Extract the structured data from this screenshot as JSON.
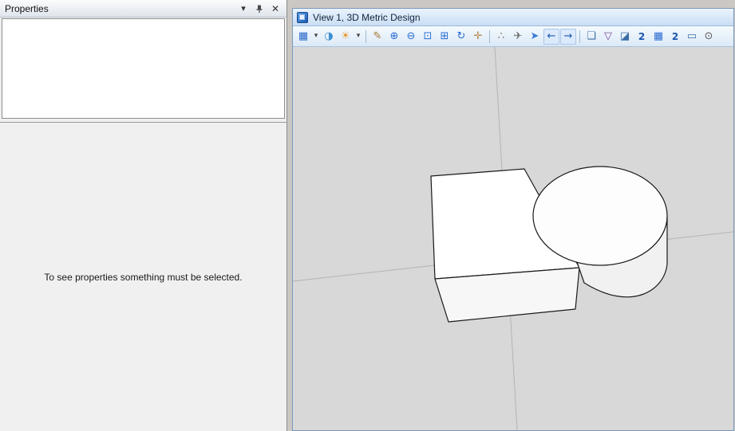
{
  "properties_panel": {
    "title": "Properties",
    "empty_message": "To see properties something must be selected.",
    "menu_caret_glyph": "▾",
    "close_glyph": "✕"
  },
  "view_window": {
    "title": "View 1, 3D Metric Design",
    "toolbar": {
      "items": [
        {
          "name": "view-attributes",
          "glyph": "▦",
          "color": "#2a66c8"
        },
        {
          "name": "view-attributes-caret",
          "glyph": "▾",
          "color": "#444",
          "narrow": true
        },
        {
          "name": "display-style",
          "glyph": "◑",
          "color": "#3a8fd0"
        },
        {
          "name": "adjust-view-brightness",
          "glyph": "☀",
          "color": "#e8982a"
        },
        {
          "name": "brightness-caret",
          "glyph": "▾",
          "color": "#444",
          "narrow": true
        },
        {
          "type": "separator"
        },
        {
          "name": "update-view",
          "glyph": "✎",
          "color": "#a9742f"
        },
        {
          "name": "zoom-in",
          "glyph": "⊕",
          "color": "#2b6cd4"
        },
        {
          "name": "zoom-out",
          "glyph": "⊖",
          "color": "#2b6cd4"
        },
        {
          "name": "window-area",
          "glyph": "⊡",
          "color": "#2b6cd4"
        },
        {
          "name": "fit-view",
          "glyph": "⊞",
          "color": "#2b6cd4"
        },
        {
          "name": "rotate-view",
          "glyph": "↻",
          "color": "#2b6cd4"
        },
        {
          "name": "pan-view",
          "glyph": "✛",
          "color": "#b8874f"
        },
        {
          "type": "separator"
        },
        {
          "name": "walk",
          "glyph": "∴",
          "color": "#7a6a5a"
        },
        {
          "name": "fly",
          "glyph": "✈",
          "color": "#6a6a6a"
        },
        {
          "name": "navigate-view",
          "glyph": "➤",
          "color": "#3a7ad4"
        },
        {
          "name": "view-previous",
          "glyph": "←",
          "color": "#1a57b0",
          "boxed": true
        },
        {
          "name": "view-next",
          "glyph": "→",
          "color": "#1a57b0",
          "boxed": true
        },
        {
          "type": "separator"
        },
        {
          "name": "copy-view",
          "glyph": "❏",
          "color": "#3a6ea5"
        },
        {
          "name": "clip-volume",
          "glyph": "▽",
          "color": "#7a4a9c"
        },
        {
          "name": "clip-mask",
          "glyph": "◪",
          "color": "#3a6ea5"
        },
        {
          "name": "depth-forward",
          "glyph": "2",
          "color": "#1a57b0",
          "digit": true
        },
        {
          "name": "saved-views",
          "glyph": "▦",
          "color": "#2b6cd4"
        },
        {
          "name": "depth-backward",
          "glyph": "2",
          "color": "#1a57b0",
          "digit": true
        },
        {
          "name": "view-dialog",
          "glyph": "▭",
          "color": "#3a6ea5"
        },
        {
          "name": "camera-view",
          "glyph": "⊙",
          "color": "#555555"
        }
      ]
    }
  },
  "colors": {
    "view_titlebar_top": "#ebf4fe",
    "view_titlebar_bottom": "#c9ddf3",
    "viewport_background": "#d8d8d8",
    "panel_background": "#f0f0f0",
    "model_outline": "#1a1a1a",
    "axis_line": "#b4b4b4"
  }
}
